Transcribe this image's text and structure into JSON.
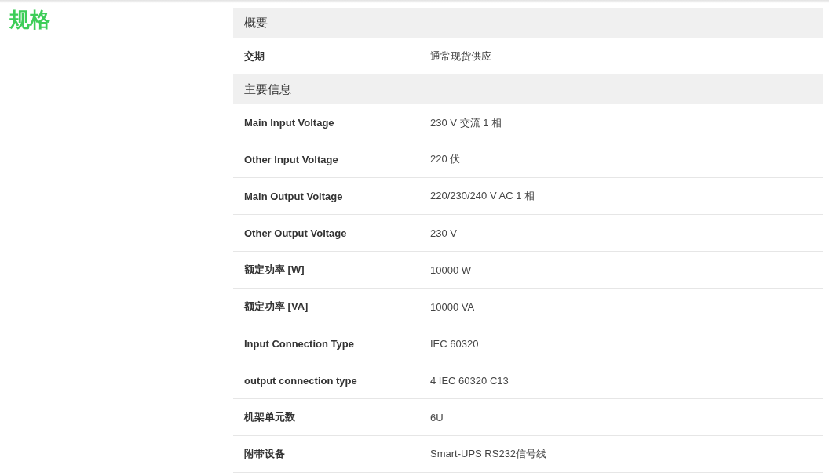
{
  "title": "规格",
  "sections": [
    {
      "title": "概要",
      "rows": [
        {
          "label": "交期",
          "value": "通常现货供应"
        }
      ]
    },
    {
      "title": "主要信息",
      "rows": [
        {
          "label": "Main Input Voltage",
          "value": "230 V 交流 1 相"
        },
        {
          "label": "Other Input Voltage",
          "value": "220 伏"
        },
        {
          "label": "Main Output Voltage",
          "value": "220/230/240 V AC 1 相"
        },
        {
          "label": "Other Output Voltage",
          "value": "230 V"
        },
        {
          "label": "额定功率 [W]",
          "value": "10000 W"
        },
        {
          "label": "额定功率 [VA]",
          "value": "10000 VA"
        },
        {
          "label": "Input Connection Type",
          "value": "IEC 60320"
        },
        {
          "label": "output connection type",
          "value": "4 IEC 60320 C13"
        },
        {
          "label": "机架单元数",
          "value": "6U"
        },
        {
          "label": "附带设备",
          "value": "Smart-UPS RS232信号线"
        }
      ]
    }
  ]
}
